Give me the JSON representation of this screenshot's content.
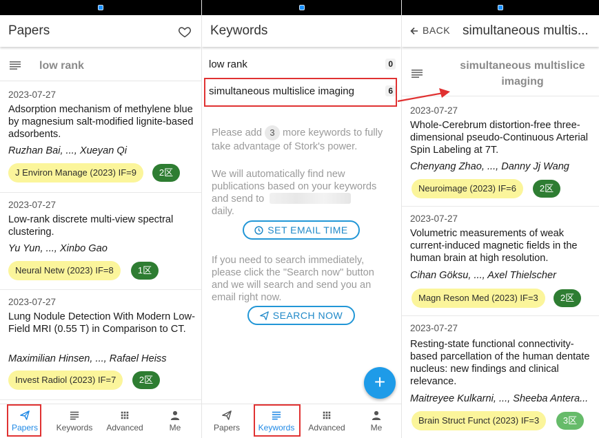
{
  "colors": {
    "accent": "#1e88e5",
    "highlight": "#e03131",
    "journal_bg": "#fbf59b",
    "zone_dark": "#2e7d32",
    "zone_light": "#66bb6a"
  },
  "papers_panel": {
    "title": "Papers",
    "filter": "low rank",
    "cards": [
      {
        "date": "2023-07-27",
        "title": "Adsorption mechanism of methylene blue by magnesium salt-modified lignite-based adsorbents.",
        "authors": "Ruzhan Bai, ..., Xueyan Qi",
        "journal": "J Environ Manage (2023)   IF=9",
        "zone": "2区"
      },
      {
        "date": "2023-07-27",
        "title": "Low-rank discrete multi-view spectral clustering.",
        "authors": "Yu Yun, ..., Xinbo Gao",
        "journal": "Neural Netw (2023)   IF=8",
        "zone": "1区"
      },
      {
        "date": "2023-07-27",
        "title": "Lung Nodule Detection With Modern Low-Field MRI (0.55 T) in Comparison to CT.",
        "authors": "Maximilian Hinsen, ..., Rafael Heiss",
        "journal": "Invest Radiol (2023)   IF=7",
        "zone": "2区"
      }
    ]
  },
  "keywords_panel": {
    "title": "Keywords",
    "keywords": [
      {
        "label": "low rank",
        "count": "0"
      },
      {
        "label": "simultaneous multislice imaging",
        "count": "6"
      }
    ],
    "info_prefix": "Please add",
    "info_count": "3",
    "info_suffix": "more keywords to fully take advantage of Stork's power.",
    "auto_text": "We will automatically find new publications based on your keywords and send to",
    "auto_tail": "daily.",
    "email_button": "SET EMAIL TIME",
    "search_text": "If you need to search immediately, please click the \"Search now\" button and we will search and send you an email right now.",
    "search_button": "SEARCH NOW",
    "fab": "+"
  },
  "detail_panel": {
    "back": "BACK",
    "title": "simultaneous multis...",
    "filter": "simultaneous multislice imaging",
    "cards": [
      {
        "date": "2023-07-27",
        "title": "Whole-Cerebrum distortion-free three-dimensional pseudo-Continuous Arterial Spin Labeling at 7T.",
        "authors": "Chenyang Zhao, ..., Danny Jj Wang",
        "journal": "Neuroimage (2023)   IF=6",
        "zone": "2区"
      },
      {
        "date": "2023-07-27",
        "title": "Volumetric measurements of weak current-induced magnetic fields in the human brain at high resolution.",
        "authors": "Cihan Göksu, ..., Axel Thielscher",
        "journal": "Magn Reson Med (2023)   IF=3",
        "zone": "2区"
      },
      {
        "date": "2023-07-27",
        "title": "Resting-state functional connectivity-based parcellation of the human dentate nucleus: new findings and clinical relevance.",
        "authors": "Maitreyee Kulkarni, ..., Sheeba Antera...",
        "journal": "Brain Struct Funct (2023)   IF=3",
        "zone": "3区"
      }
    ]
  },
  "nav": {
    "papers": "Papers",
    "keywords": "Keywords",
    "advanced": "Advanced",
    "me": "Me"
  }
}
